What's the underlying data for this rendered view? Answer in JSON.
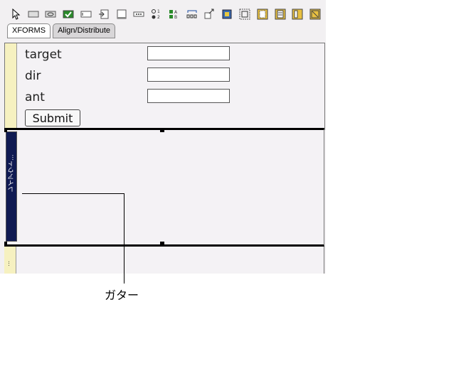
{
  "toolbar": {
    "icons": [
      "pointer-icon",
      "input-icon",
      "select-icon",
      "checkbox-icon",
      "textarea-icon",
      "upload-icon",
      "group-icon",
      "range-icon",
      "radio-list-icon",
      "select-list-icon",
      "repeat-icon",
      "trigger-icon",
      "image-icon",
      "layout-icon",
      "switch-icon",
      "case-icon",
      "columns-icon",
      "column-icon"
    ]
  },
  "tabs": [
    {
      "label": "XFORMS",
      "active": true
    },
    {
      "label": "Align/Distribute",
      "active": false
    }
  ],
  "form": {
    "fields": [
      {
        "label": "target",
        "value": ""
      },
      {
        "label": "dir",
        "value": ""
      },
      {
        "label": "ant",
        "value": ""
      }
    ],
    "submit_label": "Submit"
  },
  "layout_section": {
    "gutter_label": "レイアウト..."
  },
  "next_section": {
    "gutter_label": "..."
  },
  "callout": {
    "label": "ガター"
  },
  "colors": {
    "gutter_yellow": "#f6f1c0",
    "gutter_selected": "#0f1a52",
    "canvas": "#f4f2f5"
  }
}
